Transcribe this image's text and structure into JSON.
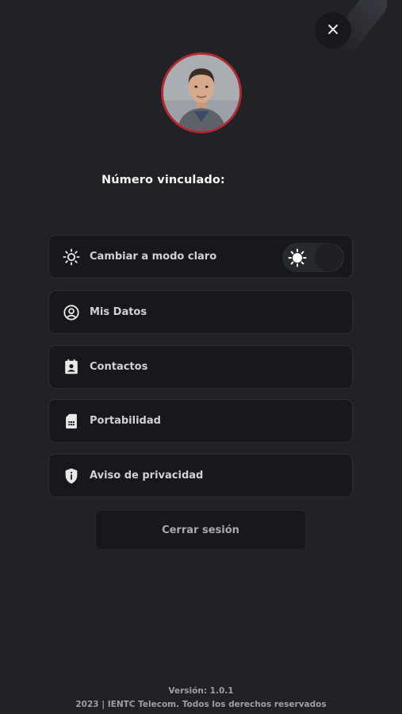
{
  "header": {
    "close_icon": "close-icon"
  },
  "profile": {
    "linked_number_label": "Número vinculado:",
    "linked_number_value": "",
    "avatar_border_color": "#b5262e"
  },
  "menu": {
    "items": [
      {
        "label": "Cambiar a modo claro",
        "icon": "sun-icon",
        "toggle": {
          "state": "off",
          "icon": "sun-icon"
        }
      },
      {
        "label": "Mis Datos",
        "icon": "user-circle-icon"
      },
      {
        "label": "Contactos",
        "icon": "contacts-icon"
      },
      {
        "label": "Portabilidad",
        "icon": "sim-card-icon"
      },
      {
        "label": "Aviso de privacidad",
        "icon": "shield-info-icon"
      }
    ]
  },
  "actions": {
    "logout_label": "Cerrar sesión"
  },
  "footer": {
    "version": "Versión: 1.0.1",
    "copyright": "2023 | IENTC Telecom. Todos los derechos reservados"
  },
  "theme": {
    "background": "#202226",
    "card": "#16181b",
    "text": "#cfd1d4"
  }
}
